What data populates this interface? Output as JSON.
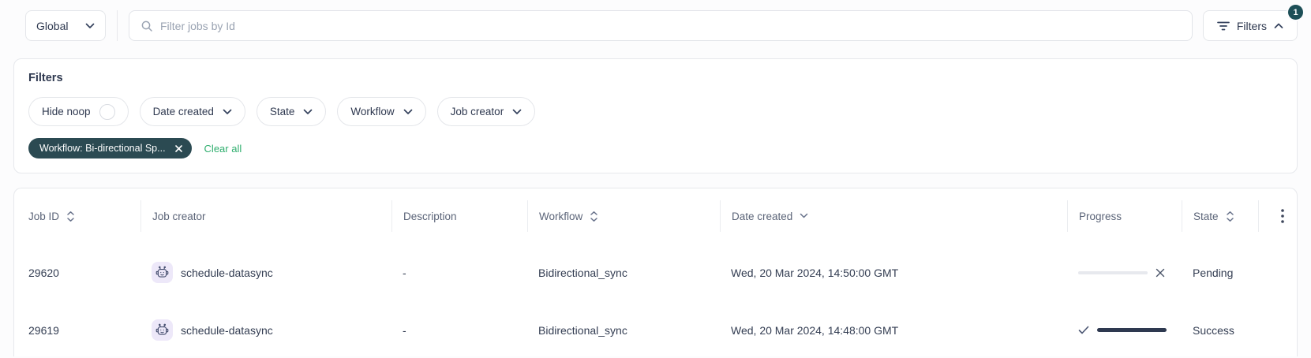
{
  "topbar": {
    "scope": {
      "label": "Global"
    },
    "search": {
      "placeholder": "Filter jobs by Id",
      "value": ""
    },
    "filters_button": {
      "label": "Filters",
      "badge_count": "1"
    }
  },
  "filters_panel": {
    "title": "Filters",
    "hide_noop": {
      "label": "Hide noop",
      "enabled": false
    },
    "dropdown_filters": [
      {
        "label": "Date created"
      },
      {
        "label": "State"
      },
      {
        "label": "Workflow"
      },
      {
        "label": "Job creator"
      }
    ],
    "active_filters": [
      {
        "label": "Workflow: Bi-directional Sp..."
      }
    ],
    "clear_all_label": "Clear all"
  },
  "jobs_table": {
    "columns": [
      {
        "label": "Job ID",
        "sort": "both"
      },
      {
        "label": "Job creator",
        "sort": null
      },
      {
        "label": "Description",
        "sort": null
      },
      {
        "label": "Workflow",
        "sort": "both"
      },
      {
        "label": "Date created",
        "sort": "desc"
      },
      {
        "label": "Progress",
        "sort": null
      },
      {
        "label": "State",
        "sort": "both"
      }
    ],
    "rows": [
      {
        "job_id": "29620",
        "job_creator": "schedule-datasync",
        "description": "-",
        "workflow": "Bidirectional_sync",
        "date_created": "Wed, 20 Mar 2024, 14:50:00 GMT",
        "progress_pct": 0,
        "state": "Pending"
      },
      {
        "job_id": "29619",
        "job_creator": "schedule-datasync",
        "description": "-",
        "workflow": "Bidirectional_sync",
        "date_created": "Wed, 20 Mar 2024, 14:48:00 GMT",
        "progress_pct": 100,
        "state": "Success"
      }
    ]
  },
  "colors": {
    "text_primary": "#333d52",
    "text_column_header": "#5b6478",
    "chip_background": "#2b4a52",
    "badge_background": "#1d4f57",
    "clear_all_green": "#2fae6e",
    "avatar_background": "#ede8f9",
    "progress_fill": "#2e3950",
    "progress_track": "#e7e9ee",
    "card_border": "#e6e8ec"
  }
}
